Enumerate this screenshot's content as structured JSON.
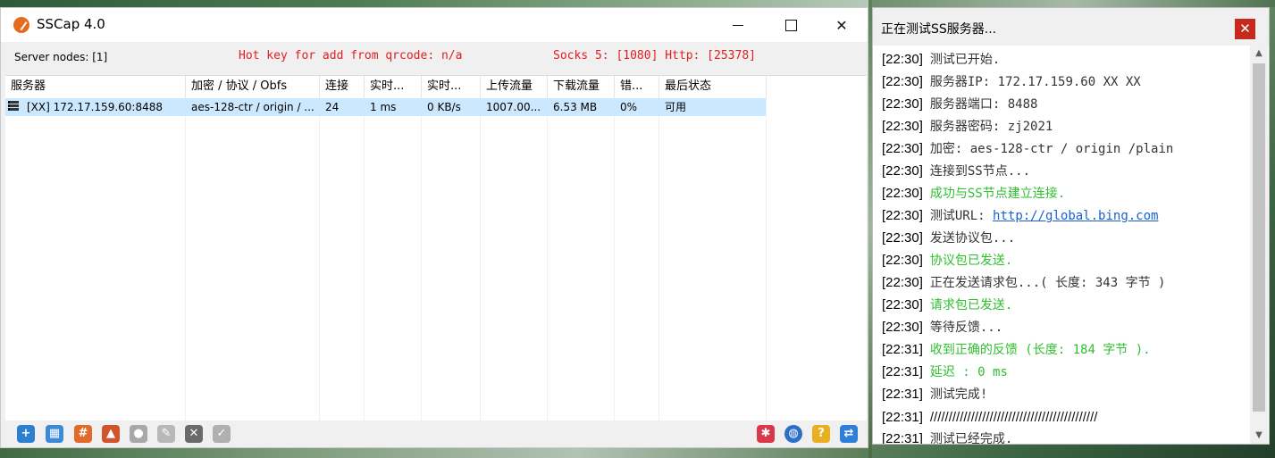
{
  "main": {
    "title": "SSCap 4.0",
    "controls": {
      "minimize": "",
      "maximize": "",
      "close": "✕"
    },
    "server_nodes": "Server nodes: [1]",
    "hotkey": "Hot key for add from qrcode: n/a",
    "ports": "Socks 5: [1080] Http: [25378]",
    "columns": [
      "服务器",
      "加密 / 协议 / Obfs",
      "连接",
      "实时...",
      "实时...",
      "上传流量",
      "下载流量",
      "错...",
      "最后状态"
    ],
    "rows": [
      {
        "server": "[XX] 172.17.159.60:8488",
        "encryption": "aes-128-ctr / origin / ...",
        "connections": "24",
        "latency": "1 ms",
        "speed": "0 KB/s",
        "upload": "1007.00...",
        "download": "6.53 MB",
        "error": "0%",
        "status": "可用"
      }
    ],
    "toolbar_icons": [
      "add-icon",
      "qrcode-icon",
      "grid-icon",
      "share-icon",
      "bulb-icon",
      "edit-icon",
      "delete-icon",
      "check-icon",
      "settings-icon",
      "globe-icon",
      "help-icon",
      "switch-icon"
    ]
  },
  "test": {
    "title": "正在测试SS服务器...",
    "close": "✕",
    "log": [
      {
        "time": "[22:30]",
        "msg": "测试已开始.",
        "style": "normal"
      },
      {
        "time": "[22:30]",
        "msg": "服务器IP: 172.17.159.60 XX XX",
        "style": "normal"
      },
      {
        "time": "[22:30]",
        "msg": "服务器端口: 8488",
        "style": "normal"
      },
      {
        "time": "[22:30]",
        "msg": "服务器密码: zj2021",
        "style": "normal"
      },
      {
        "time": "[22:30]",
        "msg": "加密: aes-128-ctr / origin /plain",
        "style": "normal"
      },
      {
        "time": "[22:30]",
        "msg": "连接到SS节点...",
        "style": "normal"
      },
      {
        "time": "[22:30]",
        "msg": "成功与SS节点建立连接.",
        "style": "green"
      },
      {
        "time": "[22:30]",
        "msg": "测试URL: ",
        "link": "http://global.bing.com",
        "style": "normal"
      },
      {
        "time": "[22:30]",
        "msg": "发送协议包...",
        "style": "normal"
      },
      {
        "time": "[22:30]",
        "msg": "协议包已发送.",
        "style": "green"
      },
      {
        "time": "[22:30]",
        "msg": "正在发送请求包...( 长度: 343 字节 )",
        "style": "normal"
      },
      {
        "time": "[22:30]",
        "msg": "请求包已发送.",
        "style": "green"
      },
      {
        "time": "[22:30]",
        "msg": "等待反馈...",
        "style": "normal"
      },
      {
        "time": "[22:31]",
        "msg": "收到正确的反馈 (长度: 184 字节 ).",
        "style": "green"
      },
      {
        "time": "[22:31]",
        "msg": "延迟 : 0 ms",
        "style": "green"
      },
      {
        "time": "[22:31]",
        "msg": "测试完成!",
        "style": "normal"
      },
      {
        "time": "[22:31]",
        "msg": "/////////////////////////////////////////////",
        "style": "slash"
      },
      {
        "time": "[22:31]",
        "msg": "测试已经完成.",
        "style": "normal"
      }
    ]
  },
  "colors": {
    "selection": "#cce8ff",
    "red_text": "#e02020",
    "green_text": "#2fbf2f",
    "link": "#1a5fd0",
    "close_red": "#c42b1c"
  }
}
